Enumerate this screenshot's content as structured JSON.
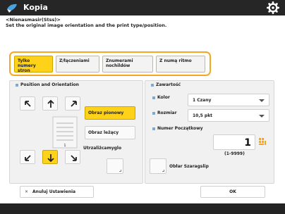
{
  "app": {
    "title": "Kopia",
    "icon": "copy-app-icon"
  },
  "instruction": {
    "line1": "<Nienasmasir(Stss)>",
    "line2": "Set the original image orientation and the print type/position."
  },
  "tabs": [
    {
      "label": "Tylko numery stron",
      "active": true
    },
    {
      "label": "Z/łączeniami",
      "active": false
    },
    {
      "label": "Znumerami nochildów",
      "active": false
    },
    {
      "label": "Z numą ritmo",
      "active": false
    }
  ],
  "position_panel": {
    "title": "Position and Orientation",
    "selected_arrow": "bottom-center",
    "page_icon_label": "1",
    "orient_options": [
      {
        "label": "Obraz pionowy",
        "selected": true
      },
      {
        "label": "Obraz leżący",
        "selected": false
      }
    ],
    "checkbox_label": "Utrzaliżcamyglo"
  },
  "settings_panel": {
    "title": "Zawartość",
    "color_label": "Kolor",
    "color_value": "1 Czany",
    "size_label": "Rozmiar",
    "size_value": "10,5 pkt",
    "start_number_label": "Numer Początkowy",
    "start_number_value": "1",
    "range_label": "(1-9999)",
    "second_checkbox_label": "Obłar Szaragslip"
  },
  "footer": {
    "cancel_label": "Anuluj Ustawienia",
    "ok_label": "OK"
  },
  "colors": {
    "accent_orange": "#f5a623",
    "selected_yellow": "#ffd21a",
    "titlebar_bg": "#262626",
    "bullet_blue": "#7fa9d1"
  }
}
